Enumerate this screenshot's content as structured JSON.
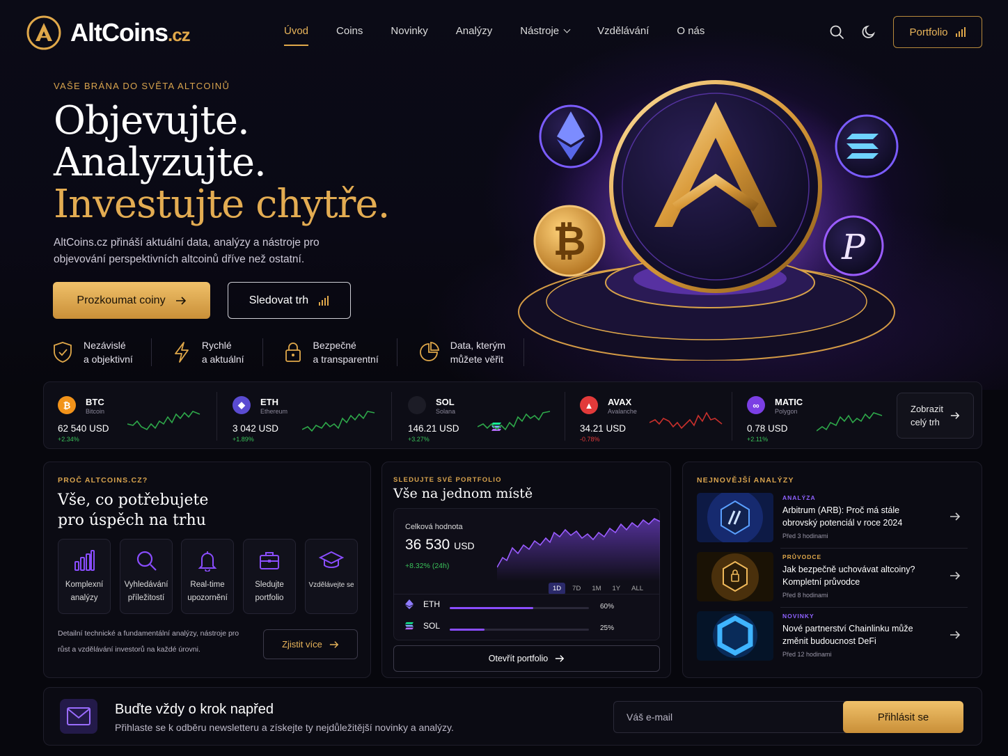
{
  "brand": {
    "name": "AltCoins",
    "tld": ".cz"
  },
  "nav": {
    "items": [
      {
        "label": "Úvod",
        "active": true
      },
      {
        "label": "Coins"
      },
      {
        "label": "Novinky"
      },
      {
        "label": "Analýzy"
      },
      {
        "label": "Nástroje",
        "dropdown": true
      },
      {
        "label": "Vzdělávání"
      },
      {
        "label": "O nás"
      }
    ],
    "portfolio_label": "Portfolio",
    "icons": [
      "search-icon",
      "moon-icon",
      "bar-chart-icon"
    ]
  },
  "hero": {
    "eyebrow": "VAŠE BRÁNA DO SVĚTA ALTCOINŮ",
    "line1": "Objevujte.",
    "line2": "Analyzujte.",
    "line3": "Investujte chytře.",
    "lead": "AltCoins.cz přináší aktuální data, analýzy a nástroje pro objevování perspektivních altcoinů dříve než ostatní.",
    "cta_primary": "Prozkoumat coiny",
    "cta_secondary": "Sledovat trh",
    "features": [
      {
        "icon": "shield-check-icon",
        "l1": "Nezávislé",
        "l2": "a objektivní"
      },
      {
        "icon": "lightning-icon",
        "l1": "Rychlé",
        "l2": "a aktuální"
      },
      {
        "icon": "lock-icon",
        "l1": "Bezpečné",
        "l2": "a transparentní"
      },
      {
        "icon": "pie-chart-icon",
        "l1": "Data, kterým",
        "l2": "můžete věřit"
      }
    ]
  },
  "ticker": {
    "coins": [
      {
        "symbol": "BTC",
        "name": "Bitcoin",
        "price": "62 540 USD",
        "change": "+2.34%",
        "trend": "up",
        "color": "#f2931a",
        "glyph": "₿"
      },
      {
        "symbol": "ETH",
        "name": "Ethereum",
        "price": "3 042 USD",
        "change": "+1.89%",
        "trend": "up",
        "color": "#5a4bd1",
        "glyph": "◆"
      },
      {
        "symbol": "SOL",
        "name": "Solana",
        "price": "146.21 USD",
        "change": "+3.27%",
        "trend": "up",
        "color": "#1c1c26",
        "glyph": "≡"
      },
      {
        "symbol": "AVAX",
        "name": "Avalanche",
        "price": "34.21 USD",
        "change": "-0.78%",
        "trend": "down",
        "color": "#e23a3a",
        "glyph": "▲"
      },
      {
        "symbol": "MATIC",
        "name": "Polygon",
        "price": "0.78 USD",
        "change": "+2.11%",
        "trend": "up",
        "color": "#7b3fe4",
        "glyph": "∞"
      }
    ],
    "all_market_l1": "Zobrazit",
    "all_market_l2": "celý trh"
  },
  "why": {
    "eyebrow": "PROČ ALTCOINS.CZ?",
    "title1": "Vše, co potřebujete",
    "title2": "pro úspěch na trhu",
    "tiles": [
      {
        "icon": "bar-chart-icon",
        "l1": "Komplexní",
        "l2": "analýzy"
      },
      {
        "icon": "search-icon",
        "l1": "Vyhledávání",
        "l2": "příležitostí"
      },
      {
        "icon": "bell-icon",
        "l1": "Real-time",
        "l2": "upozornění"
      },
      {
        "icon": "briefcase-icon",
        "l1": "Sledujte",
        "l2": "portfolio"
      },
      {
        "icon": "graduation-cap-icon",
        "l1": "Vzdělávejte se",
        "l2": ""
      }
    ],
    "text": "Detailní technické a fundamentální analýzy, nástroje pro růst a vzdělávání investorů na každé úrovni.",
    "button": "Zjistit více"
  },
  "portfolio": {
    "eyebrow": "SLEDUJTE SVÉ PORTFOLIO",
    "title": "Vše na jednom místě",
    "total_label": "Celková hodnota",
    "total_value": "36 530",
    "total_unit": "USD",
    "change": "+8.32% (24h)",
    "ranges": [
      "1D",
      "7D",
      "1M",
      "1Y",
      "ALL"
    ],
    "active_range": "1D",
    "holdings": [
      {
        "symbol": "ETH",
        "share": "60%",
        "fraction": 0.6
      },
      {
        "symbol": "SOL",
        "share": "25%",
        "fraction": 0.25
      }
    ],
    "button": "Otevřít portfolio"
  },
  "news": {
    "eyebrow": "NEJNOVĚJŠÍ ANALÝZY",
    "items": [
      {
        "category": "ANALÝZA",
        "category_color": "#8f62ff",
        "title": "Arbitrum (ARB): Proč má stále obrovský potenciál v roce 2024",
        "time": "Před 3 hodinami"
      },
      {
        "category": "PRŮVODCE",
        "category_color": "#e0a84a",
        "title": "Jak bezpečně uchovávat altcoiny? Kompletní průvodce",
        "time": "Před 8 hodinami"
      },
      {
        "category": "NOVINKY",
        "category_color": "#8f62ff",
        "title": "Nové partnerství Chainlinku může změnit budoucnost DeFi",
        "time": "Před 12 hodinami"
      }
    ]
  },
  "newsletter": {
    "title": "Buďte vždy o krok napřed",
    "subtitle": "Přihlaste se k odběru newsletteru a získejte ty nejdůležitější novinky a analýzy.",
    "placeholder": "Váš e-mail",
    "button": "Přihlásit se"
  },
  "colors": {
    "gold": "#e0a84a",
    "purple": "#8a4dff",
    "green": "#3ac25a",
    "red": "#e23a3a"
  }
}
